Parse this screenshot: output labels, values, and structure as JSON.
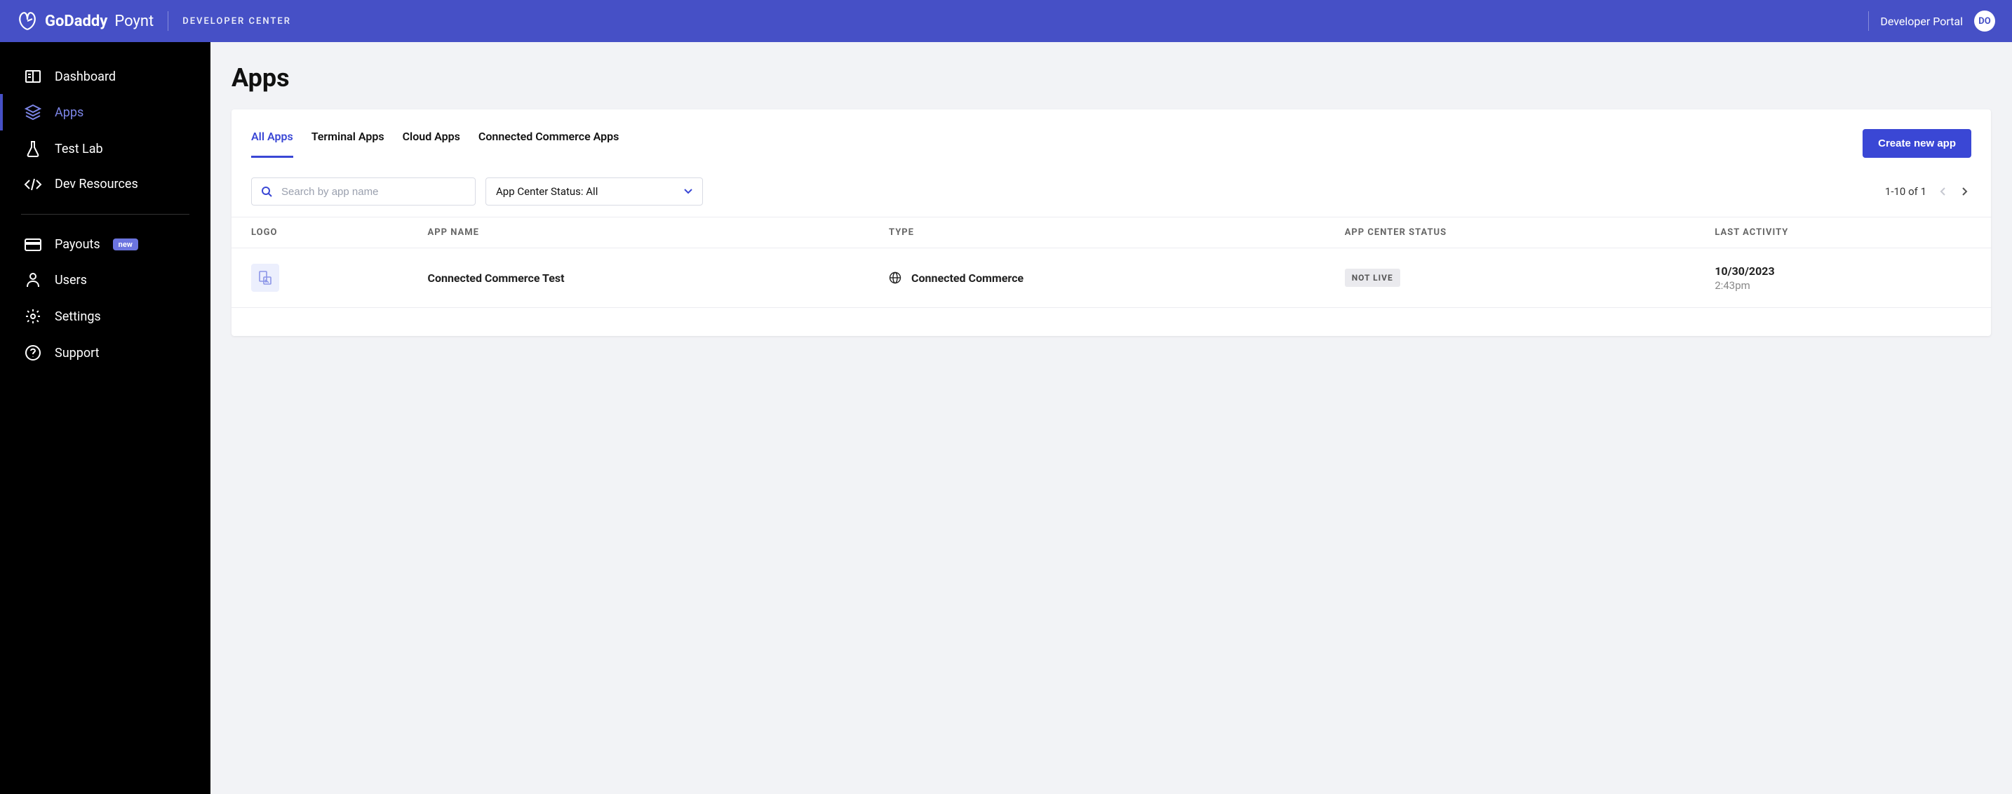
{
  "header": {
    "brand": "GoDaddy",
    "product": "Poynt",
    "subtitle": "DEVELOPER CENTER",
    "portal_label": "Developer Portal",
    "avatar_initials": "DO"
  },
  "sidebar": {
    "items": [
      {
        "label": "Dashboard",
        "icon": "dashboard-icon",
        "active": false
      },
      {
        "label": "Apps",
        "icon": "apps-icon",
        "active": true
      },
      {
        "label": "Test Lab",
        "icon": "testlab-icon",
        "active": false
      },
      {
        "label": "Dev Resources",
        "icon": "devres-icon",
        "active": false
      }
    ],
    "items2": [
      {
        "label": "Payouts",
        "icon": "payouts-icon",
        "badge": "new"
      },
      {
        "label": "Users",
        "icon": "users-icon"
      },
      {
        "label": "Settings",
        "icon": "settings-icon"
      },
      {
        "label": "Support",
        "icon": "support-icon"
      }
    ]
  },
  "page": {
    "title": "Apps"
  },
  "tabs": [
    {
      "label": "All Apps",
      "active": true
    },
    {
      "label": "Terminal Apps",
      "active": false
    },
    {
      "label": "Cloud Apps",
      "active": false
    },
    {
      "label": "Connected Commerce Apps",
      "active": false
    }
  ],
  "create_button": "Create new app",
  "search": {
    "placeholder": "Search by app name",
    "value": ""
  },
  "status_filter": {
    "label": "App Center Status: All"
  },
  "pagination": {
    "range": "1-10 of 1"
  },
  "table": {
    "columns": [
      "LOGO",
      "APP NAME",
      "TYPE",
      "APP CENTER STATUS",
      "LAST ACTIVITY"
    ],
    "rows": [
      {
        "app_name": "Connected Commerce Test",
        "type": "Connected Commerce",
        "status": "NOT LIVE",
        "activity_date": "10/30/2023",
        "activity_time": "2:43pm"
      }
    ]
  }
}
